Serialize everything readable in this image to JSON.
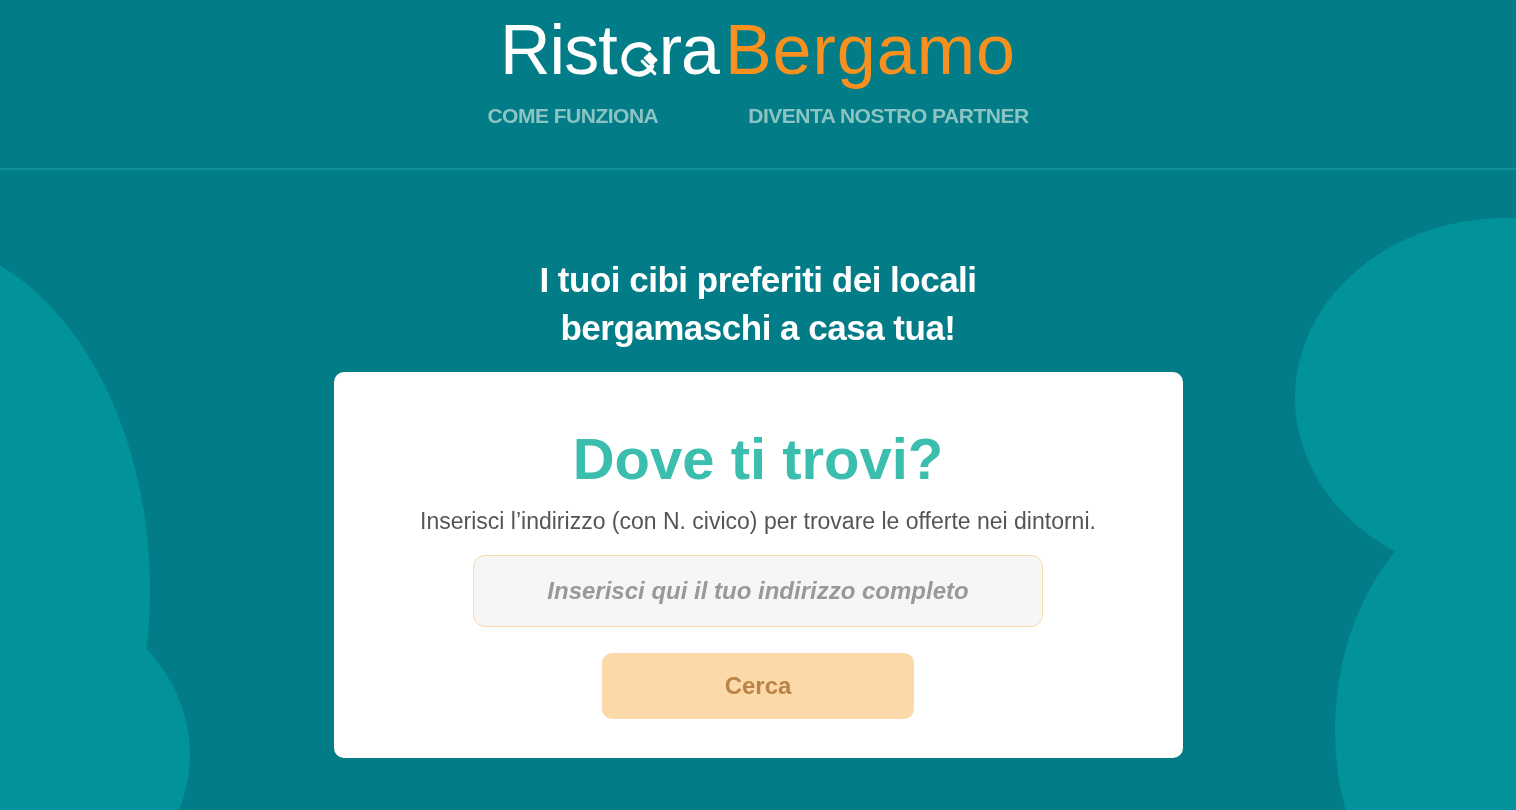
{
  "logo": {
    "part_before_icon": "Rist",
    "part_after_icon": "ra",
    "second_word": "Bergamo"
  },
  "nav": [
    {
      "label": "COME FUNZIONA"
    },
    {
      "label": "DIVENTA NOSTRO PARTNER"
    }
  ],
  "headline": [
    "I tuoi cibi preferiti dei locali",
    "bergamaschi a casa tua!"
  ],
  "card": {
    "title": "Dove ti trovi?",
    "description": "Inserisci l’indirizzo (con N. civico) per trovare le offerte nei dintorni.",
    "address": {
      "placeholder": "Inserisci qui il tuo indirizzo completo"
    },
    "button": {
      "label": "Cerca",
      "disabled": true
    }
  }
}
